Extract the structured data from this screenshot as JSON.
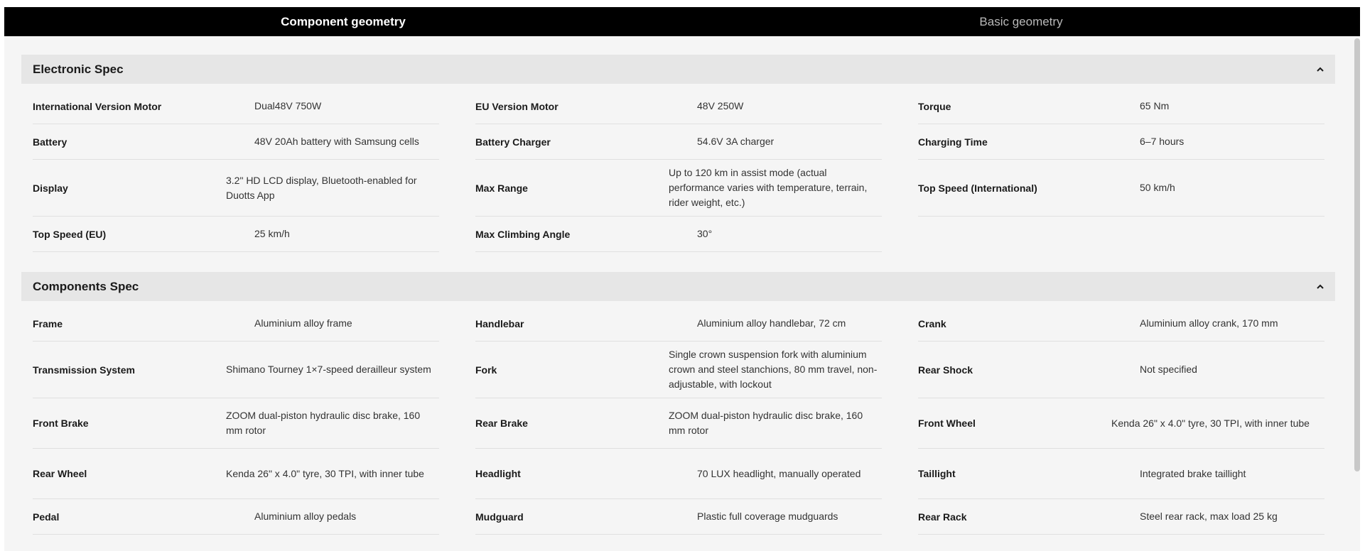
{
  "tabs": [
    {
      "label": "Component geometry",
      "active": true
    },
    {
      "label": "Basic geometry",
      "active": false
    }
  ],
  "colors": {
    "tab_bar": "#000000",
    "active_tab_text": "#ffffff",
    "inactive_tab_text": "#b9b9b9",
    "section_header_bg": "#e6e6e6",
    "page_bg": "#f5f5f5"
  },
  "icons": {
    "section_toggle": "chevron-up-icon"
  },
  "sections": [
    {
      "title": "Electronic Spec",
      "expanded": true,
      "rows": [
        [
          {
            "label": "International Version Motor",
            "value": "Dual48V 750W"
          },
          {
            "label": "EU Version Motor",
            "value": "48V 250W"
          },
          {
            "label": "Torque",
            "value": "65 Nm"
          }
        ],
        [
          {
            "label": "Battery",
            "value": "48V 20Ah battery with Samsung cells"
          },
          {
            "label": "Battery Charger",
            "value": "54.6V 3A charger"
          },
          {
            "label": "Charging Time",
            "value": "6–7 hours"
          }
        ],
        [
          {
            "label": "Display",
            "value": "3.2\" HD LCD display, Bluetooth-enabled for Duotts App"
          },
          {
            "label": "Max Range",
            "value": "Up to 120 km in assist mode (actual performance varies with temperature, terrain, rider weight, etc.)"
          },
          {
            "label": "Top Speed (International)",
            "value": "50 km/h"
          }
        ],
        [
          {
            "label": "Top Speed (EU)",
            "value": "25 km/h"
          },
          {
            "label": "Max Climbing Angle",
            "value": "30°"
          }
        ]
      ]
    },
    {
      "title": "Components Spec",
      "expanded": true,
      "rows": [
        [
          {
            "label": "Frame",
            "value": "Aluminium alloy frame"
          },
          {
            "label": "Handlebar",
            "value": "Aluminium alloy handlebar, 72 cm"
          },
          {
            "label": "Crank",
            "value": "Aluminium alloy crank, 170 mm"
          }
        ],
        [
          {
            "label": "Transmission System",
            "value": "Shimano Tourney 1×7-speed derailleur system"
          },
          {
            "label": "Fork",
            "value": "Single crown suspension fork with aluminium crown and steel stanchions, 80 mm travel, non-adjustable, with lockout"
          },
          {
            "label": "Rear Shock",
            "value": "Not specified"
          }
        ],
        [
          {
            "label": "Front Brake",
            "value": "ZOOM dual-piston hydraulic disc brake, 160 mm rotor"
          },
          {
            "label": "Rear Brake",
            "value": "ZOOM dual-piston hydraulic disc brake, 160 mm rotor"
          },
          {
            "label": "Front Wheel",
            "value": "Kenda 26\" x 4.0\" tyre, 30 TPI, with inner tube"
          }
        ],
        [
          {
            "label": "Rear Wheel",
            "value": "Kenda 26\" x 4.0\" tyre, 30 TPI, with inner tube"
          },
          {
            "label": "Headlight",
            "value": "70 LUX headlight, manually operated"
          },
          {
            "label": "Taillight",
            "value": "Integrated brake taillight"
          }
        ],
        [
          {
            "label": "Pedal",
            "value": "Aluminium alloy pedals"
          },
          {
            "label": "Mudguard",
            "value": "Plastic full coverage mudguards"
          },
          {
            "label": "Rear Rack",
            "value": "Steel rear rack, max load 25 kg"
          }
        ]
      ]
    }
  ]
}
